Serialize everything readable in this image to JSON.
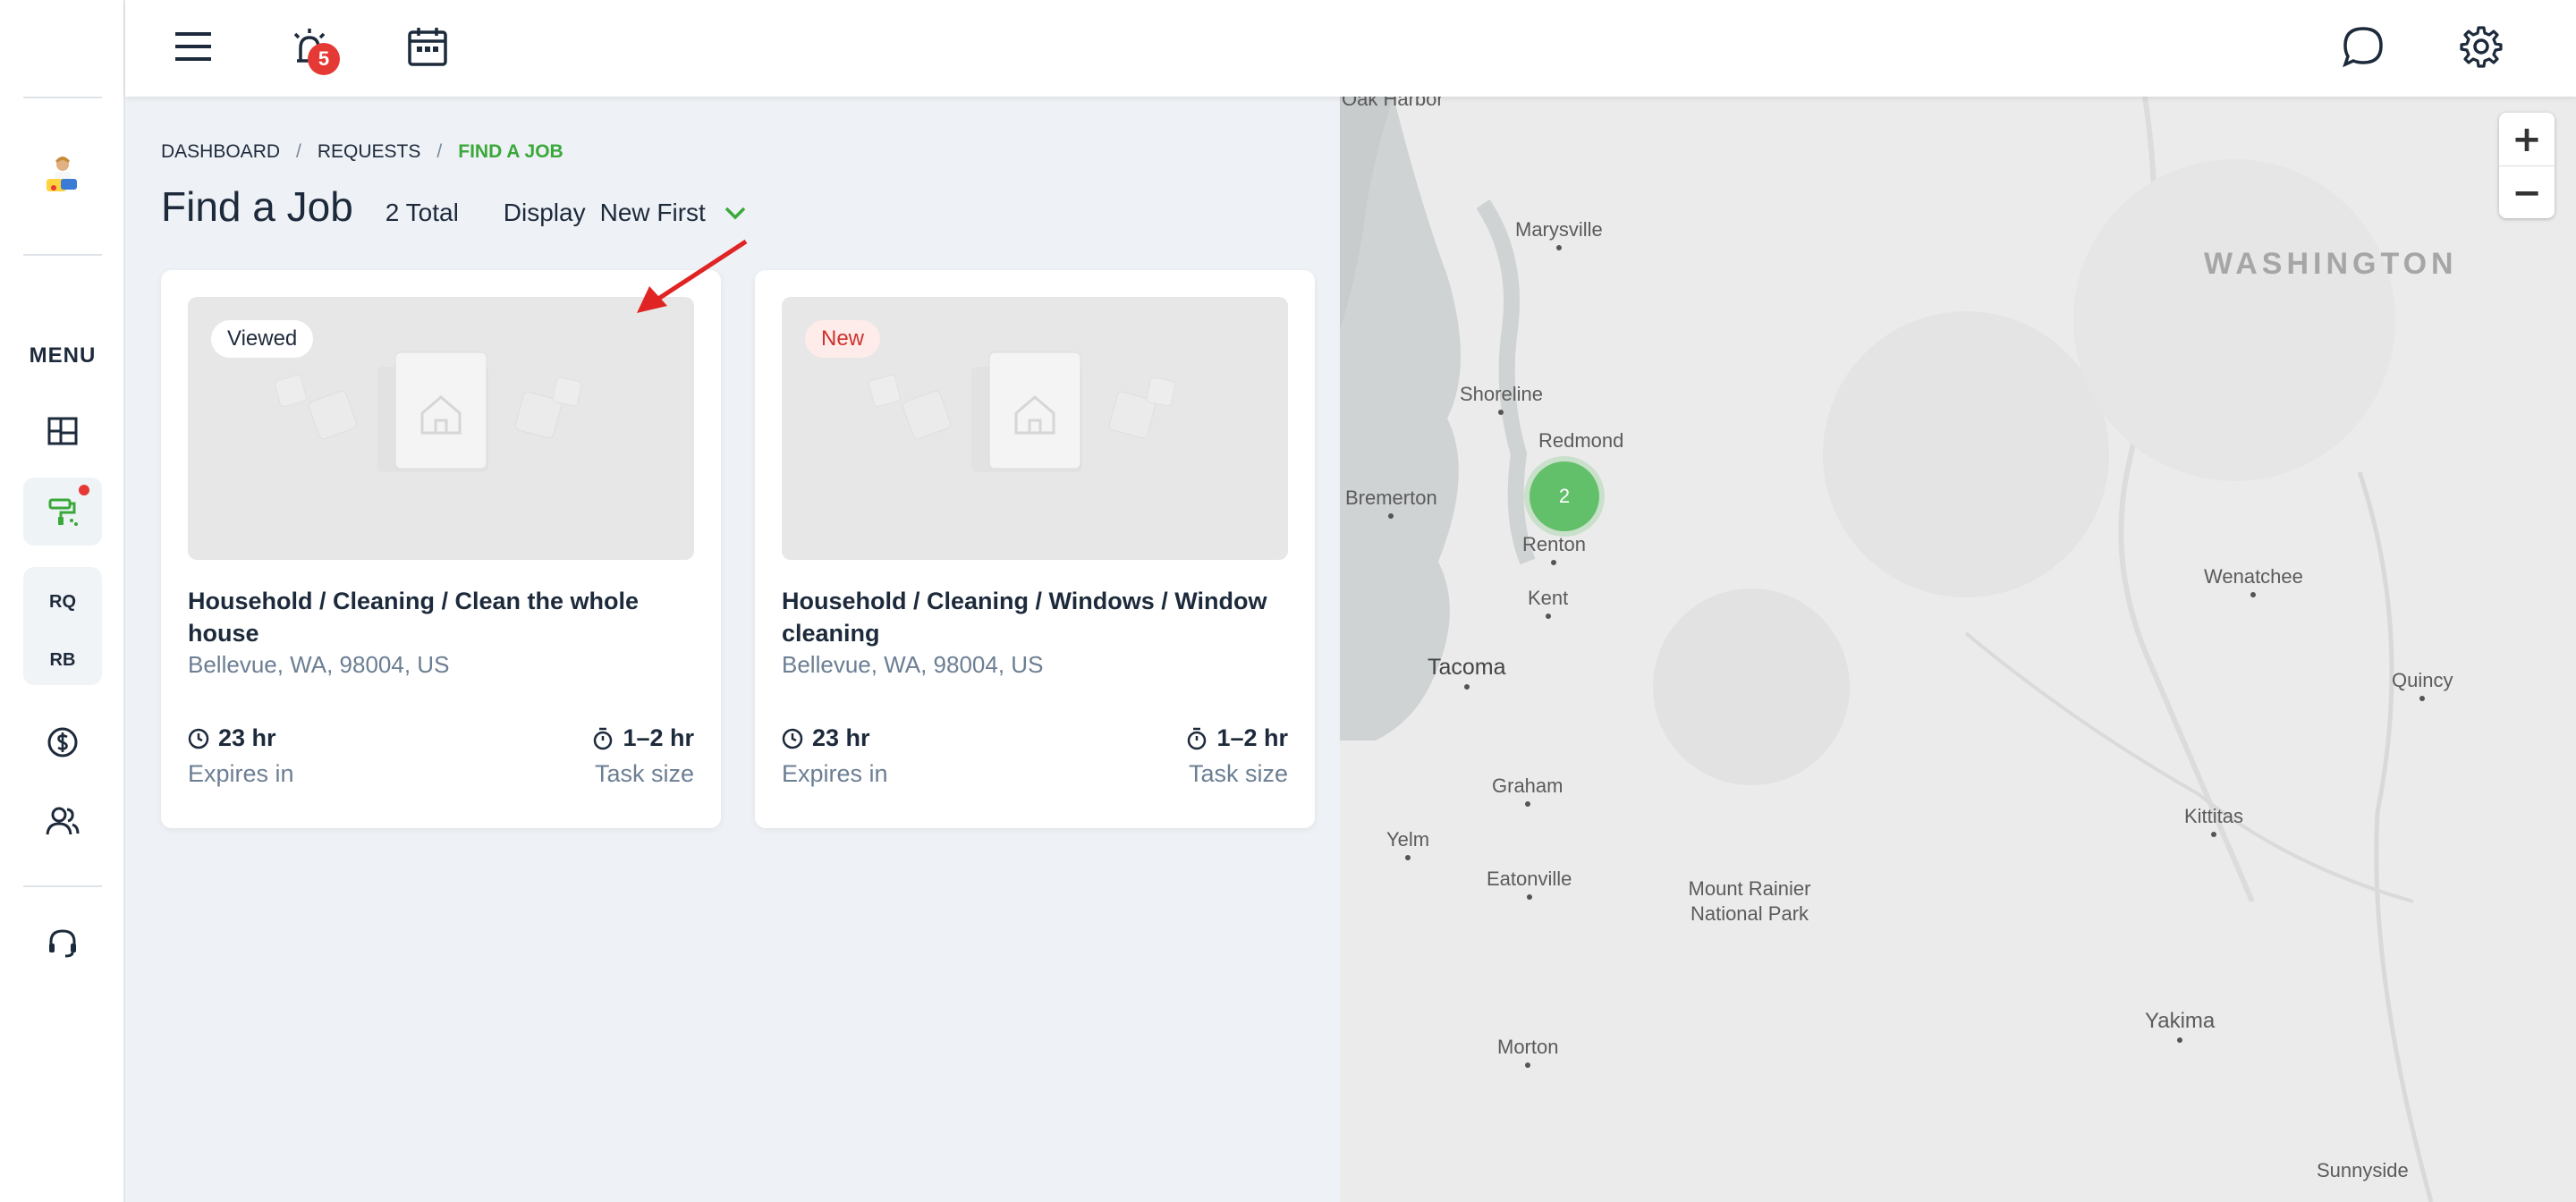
{
  "topbar": {
    "alerts_count": "5"
  },
  "sidebar": {
    "menu_label": "MENU",
    "group_items": [
      "RQ",
      "RB"
    ]
  },
  "breadcrumb": {
    "items": [
      "DASHBOARD",
      "REQUESTS",
      "FIND A JOB"
    ],
    "separator": "/"
  },
  "header": {
    "title": "Find a Job",
    "total": "2 Total",
    "display_label": "Display",
    "display_value": "New First"
  },
  "jobs": [
    {
      "status": "Viewed",
      "title": "Household / Cleaning / Clean the whole house",
      "location": "Bellevue, WA, 98004, US",
      "expires_value": "23 hr",
      "expires_label": "Expires in",
      "size_value": "1–2 hr",
      "size_label": "Task size"
    },
    {
      "status": "New",
      "title": "Household / Cleaning / Windows / Window cleaning",
      "location": "Bellevue, WA, 98004, US",
      "expires_value": "23 hr",
      "expires_label": "Expires in",
      "size_value": "1–2 hr",
      "size_label": "Task size"
    }
  ],
  "map": {
    "state": "WASHINGTON",
    "cluster_count": "2",
    "places": [
      "Oak Harbor",
      "Marysville",
      "Shoreline",
      "Redmond",
      "Bremerton",
      "Renton",
      "Kent",
      "Tacoma",
      "Graham",
      "Yelm",
      "Eatonville",
      "Mount Rainier National Park",
      "Morton",
      "Wenatchee",
      "Quincy",
      "Kittitas",
      "Yakima",
      "Sunnyside"
    ],
    "zoom_in": "+",
    "zoom_out": "−"
  },
  "colors": {
    "accent": "#3aa83a",
    "badge": "#e53935",
    "cluster": "#63c06a",
    "muted_text": "#6b7e93"
  }
}
